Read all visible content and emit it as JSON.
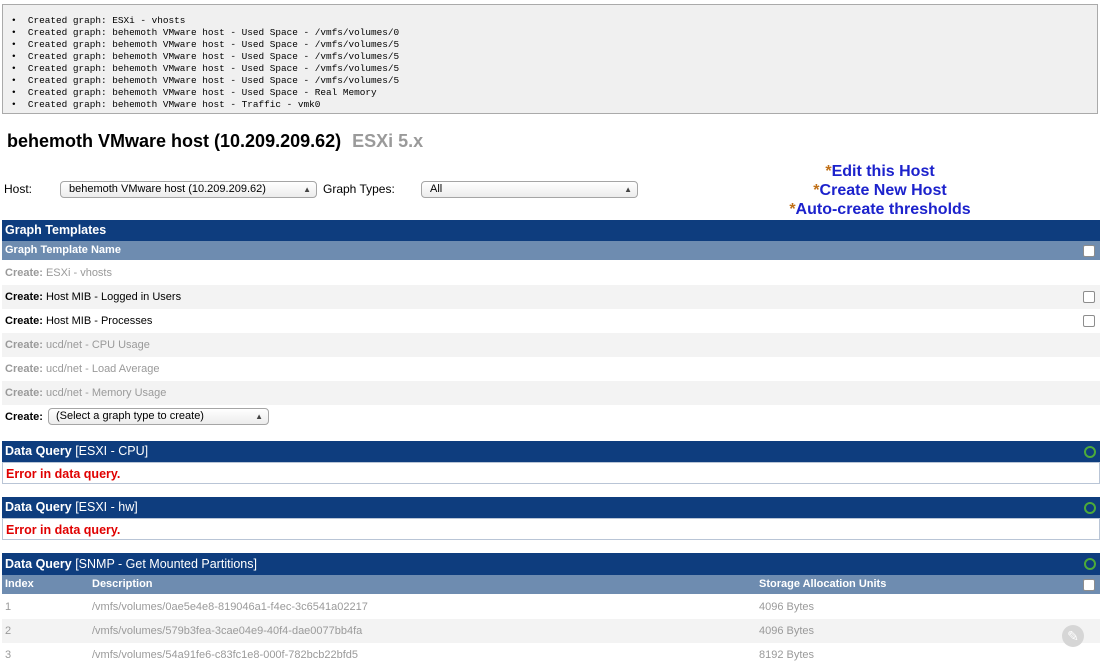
{
  "log_lines": [
    "•  Created graph: ESXi - vhosts",
    "•  Created graph: behemoth VMware host - Used Space - /vmfs/volumes/0",
    "•  Created graph: behemoth VMware host - Used Space - /vmfs/volumes/5",
    "•  Created graph: behemoth VMware host - Used Space - /vmfs/volumes/5",
    "•  Created graph: behemoth VMware host - Used Space - /vmfs/volumes/5",
    "•  Created graph: behemoth VMware host - Used Space - /vmfs/volumes/5",
    "•  Created graph: behemoth VMware host - Used Space - Real Memory",
    "•  Created graph: behemoth VMware host - Traffic - vmk0"
  ],
  "title": {
    "main": "behemoth VMware host (10.209.209.62)",
    "sub": "ESXi 5.x"
  },
  "host_select": {
    "label": "Host:",
    "value": "behemoth VMware host (10.209.209.62)"
  },
  "graph_types": {
    "label": "Graph Types:",
    "value": "All"
  },
  "links": {
    "star": "*",
    "edit": "Edit this Host",
    "create": "Create New Host",
    "auto": "Auto-create thresholds"
  },
  "graph_templates": {
    "header": "Graph Templates",
    "col_name": "Graph Template Name",
    "create_label": "Create:",
    "rows": [
      {
        "name": "ESXi - vhosts",
        "disabled": true
      },
      {
        "name": "Host MIB - Logged in Users",
        "disabled": false
      },
      {
        "name": "Host MIB - Processes",
        "disabled": false
      },
      {
        "name": "ucd/net - CPU Usage",
        "disabled": true
      },
      {
        "name": "ucd/net - Load Average",
        "disabled": true
      },
      {
        "name": "ucd/net - Memory Usage",
        "disabled": true
      }
    ],
    "create_select": "(Select a graph type to create)"
  },
  "data_queries": [
    {
      "label": "Data Query",
      "name": "[ESXI - CPU]",
      "error": "Error in data query."
    },
    {
      "label": "Data Query",
      "name": "[ESXI - hw]",
      "error": "Error in data query."
    }
  ],
  "partitions": {
    "label": "Data Query",
    "name": "[SNMP - Get Mounted Partitions]",
    "columns": [
      "Index",
      "Description",
      "Storage Allocation Units"
    ],
    "rows": [
      {
        "index": "1",
        "description": "/vmfs/volumes/0ae5e4e8-819046a1-f4ec-3c6541a02217",
        "units": "4096 Bytes"
      },
      {
        "index": "2",
        "description": "/vmfs/volumes/579b3fea-3cae04e9-40f4-dae0077bb4fa",
        "units": "4096 Bytes"
      },
      {
        "index": "3",
        "description": "/vmfs/volumes/54a91fe6-c83fc1e8-000f-782bcb22bfd5",
        "units": "8192 Bytes"
      }
    ]
  }
}
